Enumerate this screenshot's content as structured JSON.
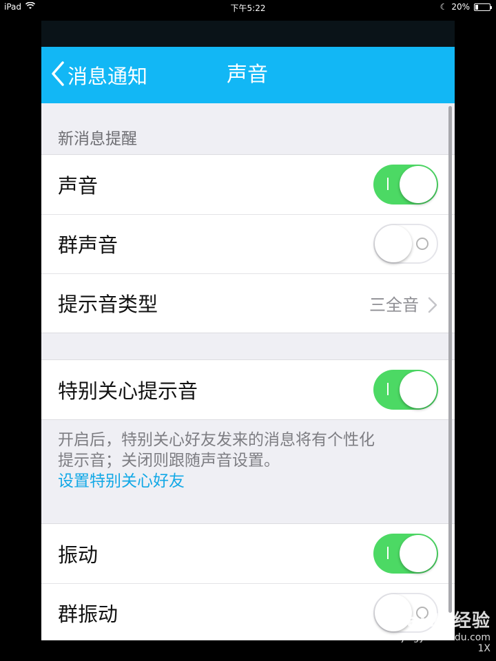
{
  "status_bar": {
    "device": "iPad",
    "time": "下午5:22",
    "battery": "20%",
    "battery_level": 0.2
  },
  "navbar": {
    "back_label": "消息通知",
    "title": "声音"
  },
  "section1": {
    "header": "新消息提醒",
    "rows": [
      {
        "label": "声音",
        "toggle": "on"
      },
      {
        "label": "群声音",
        "toggle": "off"
      },
      {
        "label": "提示音类型",
        "value": "三全音"
      }
    ]
  },
  "section2": {
    "rows": [
      {
        "label": "特别关心提示音",
        "toggle": "on"
      }
    ],
    "footer_line1": "开启后，特别关心好友发来的消息将有个性化",
    "footer_line2": "提示音；关闭则跟随声音设置。",
    "footer_link": "设置特别关心好友"
  },
  "section3": {
    "rows": [
      {
        "label": "振动",
        "toggle": "on"
      },
      {
        "label": "群振动",
        "toggle": "off"
      }
    ]
  },
  "watermark": {
    "logo": "Baidu经验",
    "url": "jingyan.baidu.com",
    "zoom": "1X"
  },
  "colors": {
    "navbar": "#12b7f5",
    "toggle_on": "#4cd964",
    "link": "#12a8e6",
    "background": "#efeff4"
  }
}
